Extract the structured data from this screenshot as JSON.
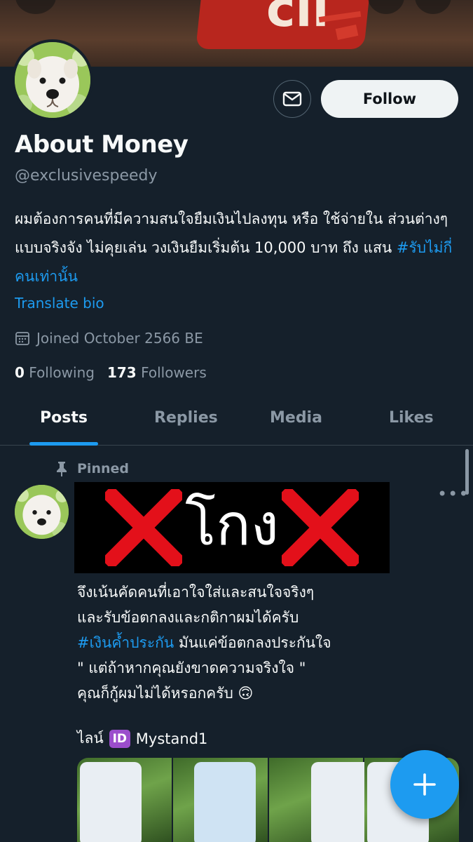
{
  "profile": {
    "name": "About Money",
    "handle": "@exclusivespeedy",
    "bio_text": "ผมต้องการคนที่มีความสนใจยืมเงินไปลงทุน หรือ ใช้จ่ายใน ส่วนต่างๆ แบบจริงจัง ไม่คุยเล่น วงเงินยืมเริ่มต้น 10,000 บาท ถึง แสน ",
    "bio_hashtag": "#รับไม่กี่คนเท่านั้น",
    "translate_label": "Translate bio",
    "joined": "Joined October 2566 BE",
    "following_count": "0",
    "following_label": "Following",
    "followers_count": "173",
    "followers_label": "Followers",
    "follow_label": "Follow",
    "banner_sign_text": "cil"
  },
  "tabs": [
    {
      "label": "Posts",
      "active": true
    },
    {
      "label": "Replies",
      "active": false
    },
    {
      "label": "Media",
      "active": false
    },
    {
      "label": "Likes",
      "active": false
    }
  ],
  "post": {
    "pinned_label": "Pinned",
    "overlay_text": "โกง",
    "lines": [
      "จึงเน้นคัดคนที่เอาใจใส่และสนใจจริงๆ",
      "และรับข้อตกลงและกติกาผมได้ครับ",
      " มันแค่ข้อตกลงประกันใจ",
      " \" แต่ถ้าหากคุณยังขาดความจริงใจ \"",
      "คุณก็กู้ผมไม่ได้หรอกครับ 🙃"
    ],
    "hashtag": "#เงินค้ำประกัน",
    "line_prefix": "ไลน์",
    "line_id_badge": "ID",
    "line_id": "Mystand1",
    "more_icon": "more-horizontal-icon"
  },
  "colors": {
    "background": "#15202b",
    "accent": "#1d9bf0",
    "muted": "#8b98a5",
    "scam_cross": "#e3101a"
  },
  "icons": {
    "message": "mail-icon",
    "calendar": "calendar-icon",
    "pin": "pin-icon",
    "compose": "plus-icon"
  }
}
